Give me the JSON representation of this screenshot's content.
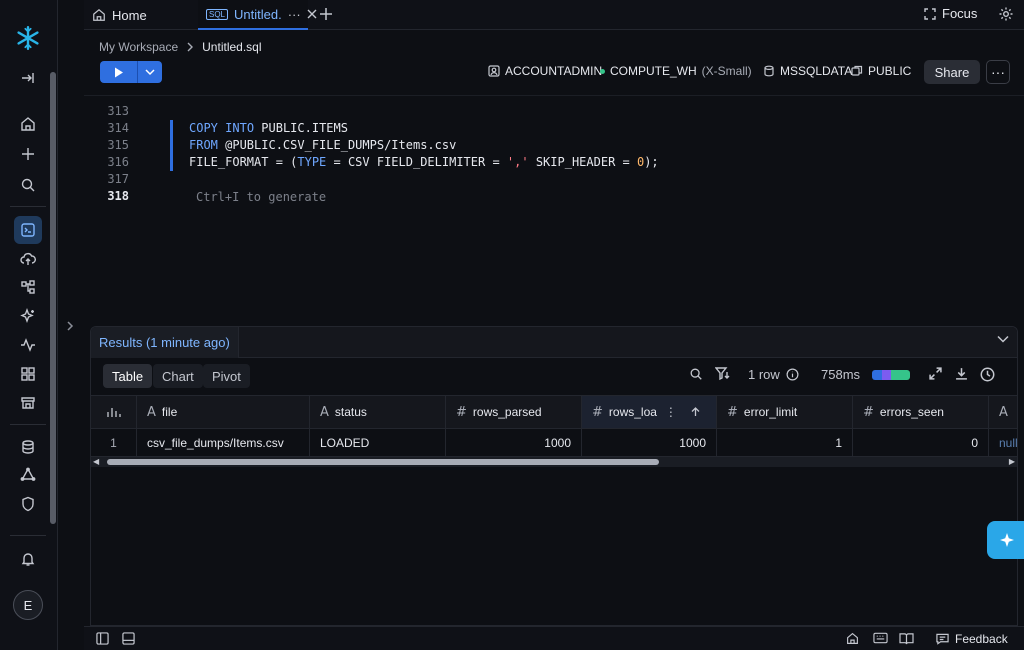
{
  "tabs": {
    "home": "Home",
    "sql_badge": "SQL",
    "active": "Untitled.",
    "active_more": "···"
  },
  "top_actions": {
    "focus": "Focus"
  },
  "breadcrumb": {
    "workspace": "My Workspace",
    "file": "Untitled.sql"
  },
  "context": {
    "role": "ACCOUNTADMIN",
    "warehouse": "COMPUTE_WH",
    "warehouse_size": "(X-Small)",
    "database": "MSSQLDATA",
    "schema": "PUBLIC"
  },
  "toolbar": {
    "share": "Share",
    "more": "···"
  },
  "editor": {
    "line_numbers": [
      "313",
      "314",
      "315",
      "316",
      "317",
      "318"
    ],
    "line314": {
      "kw1": "COPY",
      "kw2": "INTO",
      "rest": " PUBLIC.ITEMS"
    },
    "line315": {
      "kw": "FROM",
      "rest": " @PUBLIC.CSV_FILE_DUMPS/Items.csv"
    },
    "line316": {
      "p1": "FILE_FORMAT = (",
      "kw": "TYPE",
      "p2": " = CSV FIELD_DELIMITER = ",
      "str": "','",
      "p3": " SKIP_HEADER = ",
      "num": "0",
      "p4": ");"
    },
    "ghost": "Ctrl+I to generate"
  },
  "results": {
    "tab_label": "Results (1 minute ago)",
    "views": [
      "Table",
      "Chart",
      "Pivot"
    ],
    "row_count": "1 row",
    "duration": "758ms",
    "columns": [
      {
        "type": "A",
        "name": "file"
      },
      {
        "type": "A",
        "name": "status"
      },
      {
        "type": "#",
        "name": "rows_parsed"
      },
      {
        "type": "#",
        "name": "rows_load"
      },
      {
        "type": "#",
        "name": "error_limit"
      },
      {
        "type": "#",
        "name": "errors_seen"
      },
      {
        "type": "A",
        "name": ""
      }
    ],
    "rows": [
      {
        "index": "1",
        "file": "csv_file_dumps/Items.csv",
        "status": "LOADED",
        "rows_parsed": "1000",
        "rows_loaded": "1000",
        "error_limit": "1",
        "errors_seen": "0",
        "next": "null"
      }
    ]
  },
  "footer": {
    "feedback": "Feedback"
  },
  "avatar": {
    "initial": "E"
  },
  "colors": {
    "accent": "#2f6fe0",
    "latency_bar": [
      "#2f6fe0",
      "#7c5cf0",
      "#35c48a"
    ]
  }
}
